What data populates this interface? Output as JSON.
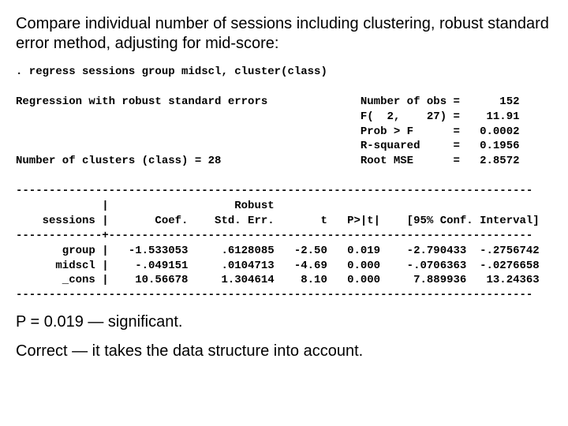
{
  "intro": "Compare individual number of sessions including clustering, robust standard error method, adjusting for mid-score:",
  "cmd": ". regress sessions group midscl, cluster(class)",
  "hdr_left": "Regression with robust standard errors",
  "clusters_line": "Number of clusters (class) = 28",
  "stats": {
    "nobs_label": "Number of obs",
    "nobs": "152",
    "f_label": "F(  2,    27)",
    "f": "11.91",
    "pf_label": "Prob > F",
    "pf": "0.0002",
    "r2_label": "R-squared",
    "r2": "0.1956",
    "rmse_label": "Root MSE",
    "rmse": "2.8572"
  },
  "table": {
    "depvar": "sessions",
    "headers": {
      "coef": "Coef.",
      "se_top": "Robust",
      "se": "Std. Err.",
      "t": "t",
      "p": "P>|t|",
      "ci": "[95% Conf. Interval]"
    },
    "rows": [
      {
        "name": "group",
        "coef": "-1.533053",
        "se": ".6128085",
        "t": "-2.50",
        "p": "0.019",
        "lo": "-2.790433",
        "hi": "-.2756742"
      },
      {
        "name": "midscl",
        "coef": "-.049151",
        "se": ".0104713",
        "t": "-4.69",
        "p": "0.000",
        "lo": "-.0706363",
        "hi": "-.0276658"
      },
      {
        "name": "_cons",
        "coef": "10.56678",
        "se": "1.304614",
        "t": "8.10",
        "p": "0.000",
        "lo": "7.889936",
        "hi": "13.24363"
      }
    ]
  },
  "chart_data": {
    "type": "table",
    "title": "Regression with robust standard errors — sessions on group, midscl (clustered by class)",
    "n_obs": 152,
    "n_clusters": 28,
    "f_stat": 11.91,
    "f_df": [
      2,
      27
    ],
    "prob_f": 0.0002,
    "r_squared": 0.1956,
    "root_mse": 2.8572,
    "columns": [
      "Coef.",
      "Robust Std. Err.",
      "t",
      "P>|t|",
      "95% CI low",
      "95% CI high"
    ],
    "rows": [
      {
        "var": "group",
        "coef": -1.533053,
        "se": 0.6128085,
        "t": -2.5,
        "p": 0.019,
        "ci": [
          -2.790433,
          -0.2756742
        ]
      },
      {
        "var": "midscl",
        "coef": -0.049151,
        "se": 0.0104713,
        "t": -4.69,
        "p": 0.0,
        "ci": [
          -0.0706363,
          -0.0276658
        ]
      },
      {
        "var": "_cons",
        "coef": 10.56678,
        "se": 1.304614,
        "t": 8.1,
        "p": 0.0,
        "ci": [
          7.889936,
          13.24363
        ]
      }
    ]
  },
  "concl1": "P = 0.019 — significant.",
  "concl2": "Correct — it takes the data structure into account."
}
